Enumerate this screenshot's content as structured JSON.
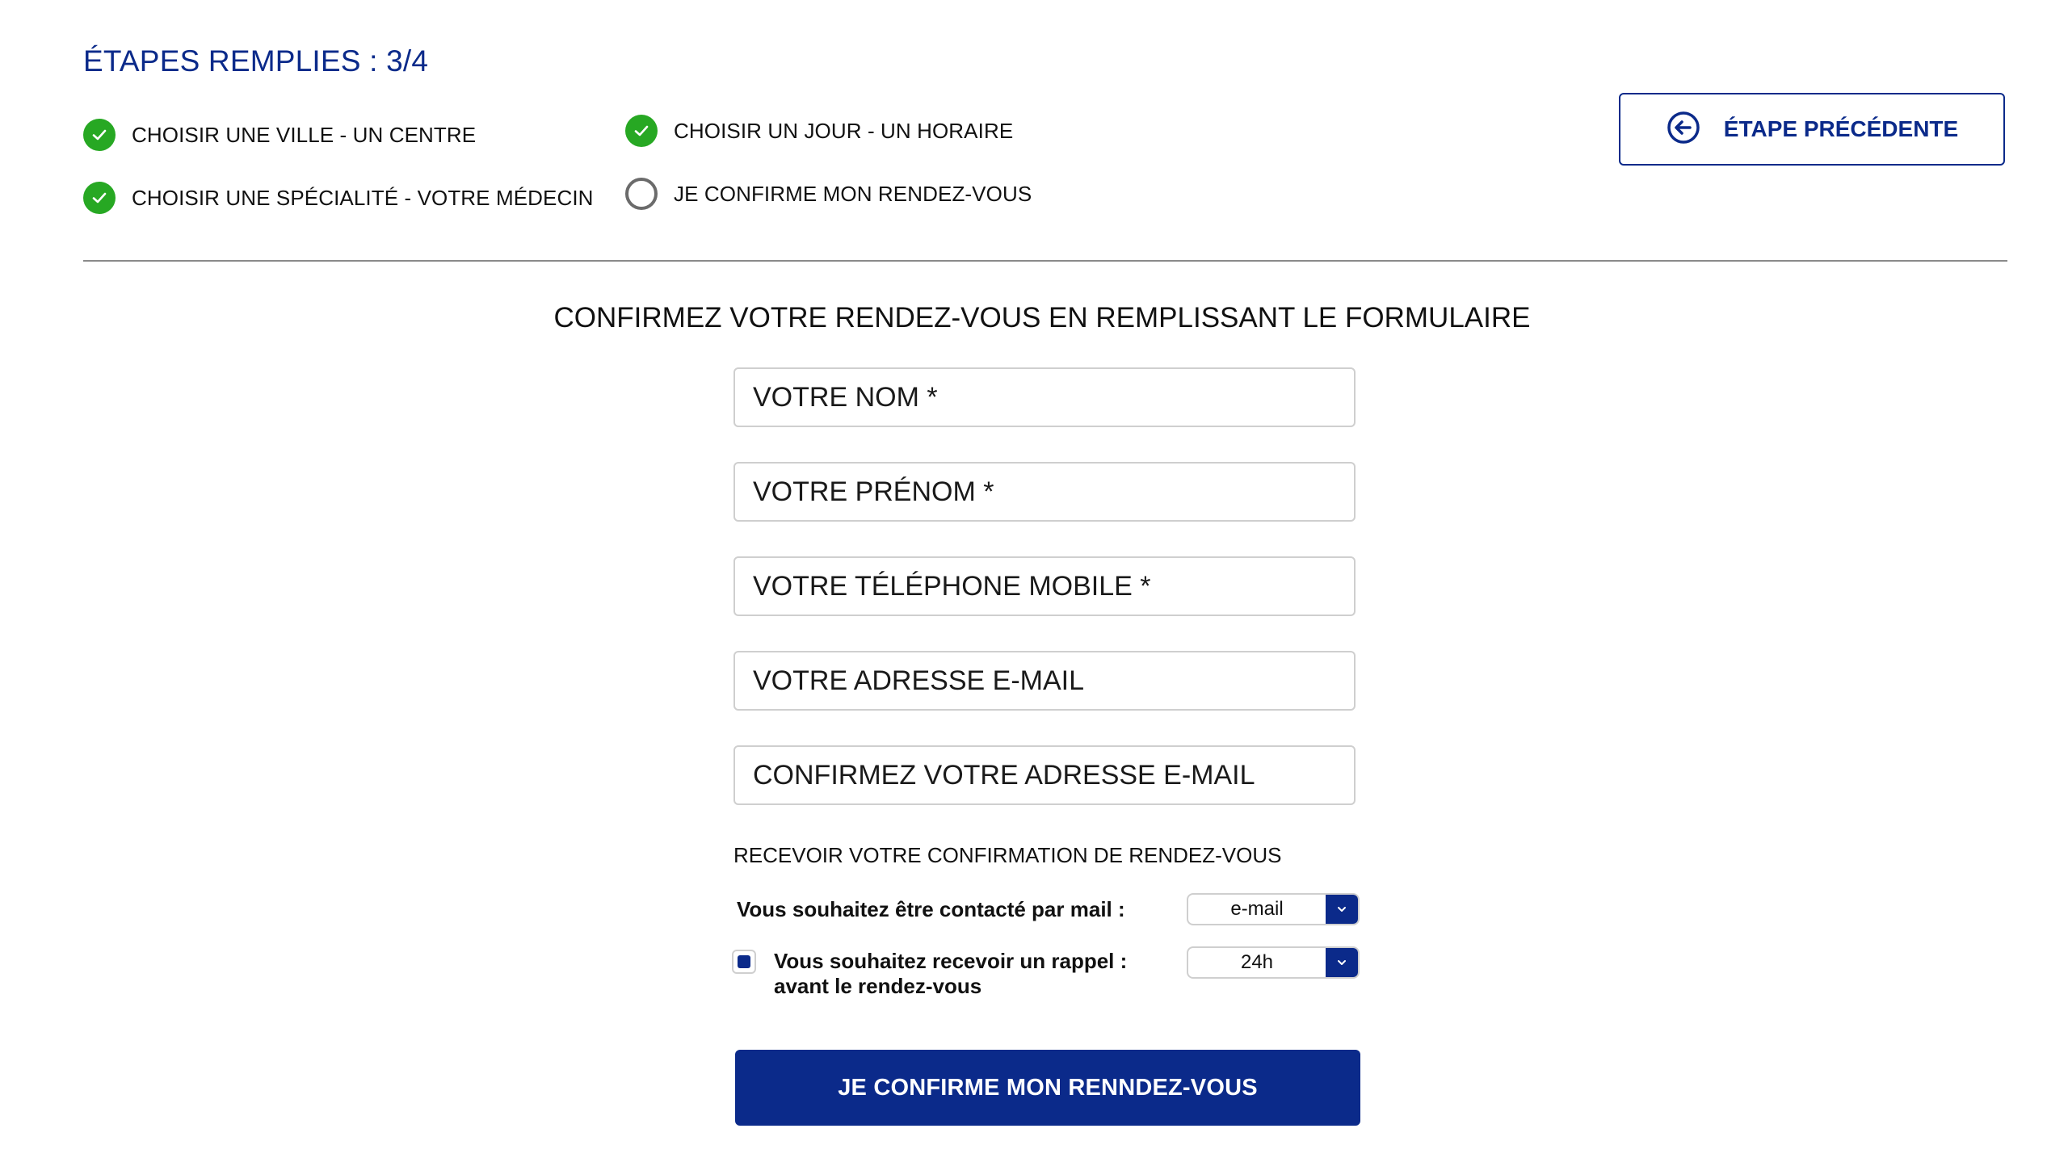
{
  "header": {
    "steps_title": "ÉTAPES REMPLIES : 3/4",
    "prev_button_label": "ÉTAPE PRÉCÉDENTE"
  },
  "steps": [
    {
      "label": "CHOISIR UNE VILLE - UN CENTRE",
      "status": "done",
      "icon": "check-circle-icon"
    },
    {
      "label": "CHOISIR UNE SPÉCIALITÉ - VOTRE MÉDECIN",
      "status": "done",
      "icon": "check-circle-icon"
    },
    {
      "label": "CHOISIR UN JOUR - UN HORAIRE",
      "status": "done",
      "icon": "check-circle-icon"
    },
    {
      "label": "JE CONFIRME MON RENDEZ-VOUS",
      "status": "pending",
      "icon": "empty-circle-icon"
    }
  ],
  "form": {
    "title": "CONFIRMEZ VOTRE RENDEZ-VOUS EN REMPLISSANT LE FORMULAIRE",
    "fields": [
      {
        "placeholder": "VOTRE NOM *",
        "value": ""
      },
      {
        "placeholder": "VOTRE PRÉNOM *",
        "value": ""
      },
      {
        "placeholder": "VOTRE TÉLÉPHONE MOBILE *",
        "value": ""
      },
      {
        "placeholder": "VOTRE ADRESSE E-MAIL",
        "value": ""
      },
      {
        "placeholder": "CONFIRMEZ VOTRE ADRESSE E-MAIL",
        "value": ""
      }
    ],
    "confirmation_section_label": "RECEVOIR VOTRE CONFIRMATION DE RENDEZ-VOUS",
    "contact_mail_label": "Vous souhaitez être contacté par mail :",
    "contact_mail_selected": "e-mail",
    "reminder_label_line1": "Vous souhaitez recevoir un rappel :",
    "reminder_label_line2": "avant le rendez-vous",
    "reminder_checked": true,
    "reminder_selected": "24h",
    "submit_label": "JE CONFIRME MON RENNDEZ-VOUS"
  },
  "colors": {
    "brand": "#0b2a8a",
    "success": "#27a823",
    "pending": "#6b6b6b",
    "divider": "#8a8a8a"
  }
}
